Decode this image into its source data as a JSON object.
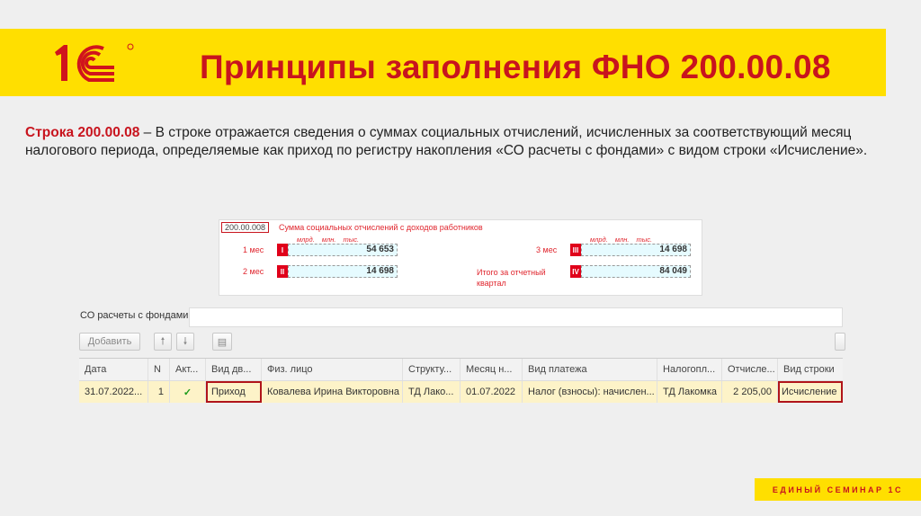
{
  "header": {
    "logo_text": "1С",
    "title": "Принципы заполнения ФНО 200.00.08"
  },
  "description": {
    "bold": "Строка 200.00.08",
    "text": " – В строке отражается сведения о суммах социальных отчислений, исчисленных за соответствующий месяц налогового периода, определяемые как приход по регистру накопления «СО расчеты с фондами» с видом строки «Исчисление»."
  },
  "form": {
    "code": "200.00.008",
    "heading": "Сумма социальных отчислений с доходов работников",
    "units": "млрд. млн. тыс.",
    "fields": [
      {
        "label": "1 мес",
        "roman": "I",
        "value": "54 653"
      },
      {
        "label": "2 мес",
        "roman": "II",
        "value": "14 698"
      },
      {
        "label": "3 мес",
        "roman": "III",
        "value": "14 698"
      },
      {
        "label": "Итого за отчетный квартал",
        "roman": "IV",
        "value": "84 049"
      }
    ]
  },
  "register": {
    "tab": "СО расчеты с фондами",
    "add_button": "Добавить",
    "columns": [
      "Дата",
      "N",
      "Акт...",
      "Вид дв...",
      "Физ. лицо",
      "Структу...",
      "Месяц н...",
      "Вид платежа",
      "Налогопл...",
      "Отчисле...",
      "Вид строки"
    ],
    "row": [
      "31.07.2022...",
      "1",
      "✓",
      "Приход",
      "Ковалева Ирина Викторовна",
      "ТД Лако...",
      "01.07.2022",
      "Налог (взносы): начислен...",
      "ТД Лакомка",
      "2 205,00",
      "Исчисление"
    ]
  },
  "footer": "ЕДИНЫЙ СЕМИНАР 1С"
}
